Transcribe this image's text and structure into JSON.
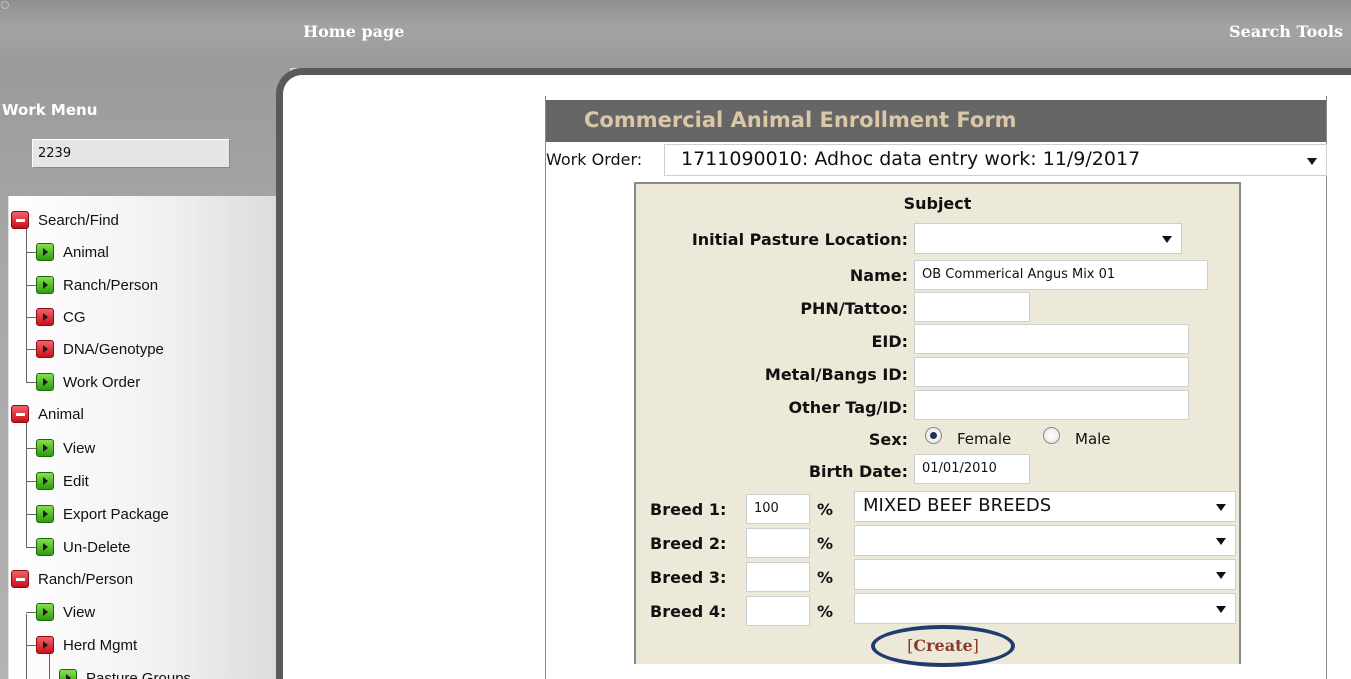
{
  "topbar": {
    "home_link": "Home page",
    "search_link": "Search Tools"
  },
  "sidebar": {
    "title": "Work Menu",
    "work_order_number": "2239",
    "items": [
      {
        "label": "Search/Find",
        "level": 0,
        "icon": "collapse-icon"
      },
      {
        "label": "Animal",
        "level": 1,
        "icon": "go-arrow-icon"
      },
      {
        "label": "Ranch/Person",
        "level": 1,
        "icon": "go-arrow-icon"
      },
      {
        "label": "CG",
        "level": 1,
        "icon": "go-arrow-icon"
      },
      {
        "label": "DNA/Genotype",
        "level": 1,
        "icon": "go-arrow-icon"
      },
      {
        "label": "Work Order",
        "level": 1,
        "icon": "go-arrow-icon"
      },
      {
        "label": "Animal",
        "level": 0,
        "icon": "collapse-icon"
      },
      {
        "label": "View",
        "level": 1,
        "icon": "go-arrow-icon"
      },
      {
        "label": "Edit",
        "level": 1,
        "icon": "go-arrow-icon"
      },
      {
        "label": "Export Package",
        "level": 1,
        "icon": "go-arrow-icon"
      },
      {
        "label": "Un-Delete",
        "level": 1,
        "icon": "go-arrow-icon"
      },
      {
        "label": "Ranch/Person",
        "level": 0,
        "icon": "collapse-icon"
      },
      {
        "label": "View",
        "level": 1,
        "icon": "go-arrow-icon"
      },
      {
        "label": "Herd Mgmt",
        "level": 1,
        "icon": "go-arrow-icon"
      },
      {
        "label": "Pasture Groups",
        "level": 2,
        "icon": "go-arrow-icon"
      }
    ]
  },
  "form": {
    "title": "Commercial Animal Enrollment Form",
    "work_order_label": "Work Order:",
    "work_order_value": "1711090010: Adhoc data entry work: 11/9/2017",
    "subject_heading": "Subject",
    "fields": {
      "initial_pasture_label": "Initial Pasture Location:",
      "initial_pasture_value": "",
      "name_label": "Name:",
      "name_value": "OB Commerical Angus Mix 01",
      "phn_label": "PHN/Tattoo:",
      "phn_value": "",
      "eid_label": "EID:",
      "eid_value": "",
      "metal_label": "Metal/Bangs ID:",
      "metal_value": "",
      "other_tag_label": "Other Tag/ID:",
      "other_tag_value": "",
      "sex_label": "Sex:",
      "sex_female": "Female",
      "sex_male": "Male",
      "sex_selected": "Female",
      "birth_date_label": "Birth Date:",
      "birth_date_value": "01/01/2010"
    },
    "breeds": [
      {
        "label": "Breed 1:",
        "pct": "100",
        "pct_sign": "%",
        "breed": "MIXED BEEF BREEDS"
      },
      {
        "label": "Breed 2:",
        "pct": "",
        "pct_sign": "%",
        "breed": ""
      },
      {
        "label": "Breed 3:",
        "pct": "",
        "pct_sign": "%",
        "breed": ""
      },
      {
        "label": "Breed 4:",
        "pct": "",
        "pct_sign": "%",
        "breed": ""
      }
    ],
    "create_open": "[",
    "create_label": "Create",
    "create_close": "]"
  },
  "colors": {
    "title_bar": "#666666",
    "title_text": "#d9c7a8",
    "subject_bg": "#ece9d8",
    "create_text": "#8b3a2b",
    "highlight_oval": "#1f3c6e"
  }
}
